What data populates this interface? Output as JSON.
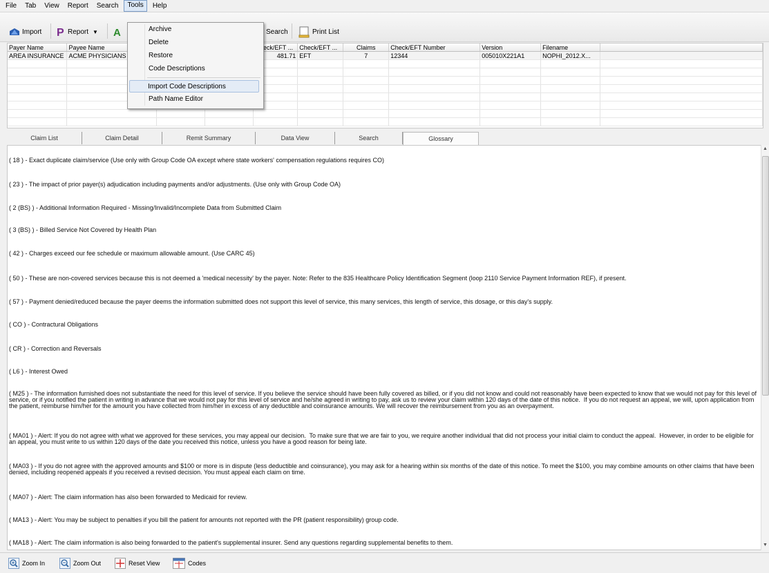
{
  "menubar": {
    "items": [
      "File",
      "Tab",
      "View",
      "Report",
      "Search",
      "Tools",
      "Help"
    ],
    "active": "Tools"
  },
  "toolbar": {
    "import_label": "Import",
    "report_label": "Report",
    "search_label": "Search",
    "print_list_label": "Print List"
  },
  "tools_menu": {
    "items": [
      "Archive",
      "Delete",
      "Restore",
      "Code Descriptions",
      "Import Code Descriptions",
      "Path Name Editor"
    ],
    "highlighted": "Import Code Descriptions"
  },
  "grid": {
    "columns": [
      "Payer Name",
      "Payee Name",
      "",
      "",
      "Check/EFT ...",
      "Check/EFT ...",
      "Claims",
      "Check/EFT Number",
      "Version",
      "Filename"
    ],
    "rows": [
      [
        "AREA INSURANCE",
        "ACME PHYSICIANS",
        "",
        "",
        "481.71",
        "EFT",
        "7",
        "12344",
        "005010X221A1",
        "NOPHI_2012.X..."
      ]
    ]
  },
  "tabs": [
    "Claim List",
    "Claim Detail",
    "Remit Summary",
    "Data View",
    "Search",
    "Glossary"
  ],
  "active_tab": "Glossary",
  "glossary": [
    "( 18 ) - Exact duplicate claim/service (Use only with Group Code OA except where state workers' compensation regulations requires CO)",
    "( 23 ) - The impact of prior payer(s) adjudication including payments and/or adjustments. (Use only with Group Code OA)",
    "( 2 (BS) ) - Additional Information Required - Missing/Invalid/Incomplete Data from Submitted Claim",
    "( 3 (BS) ) - Billed Service Not Covered by Health Plan",
    "( 42 ) - Charges exceed our fee schedule or maximum allowable amount. (Use CARC 45)",
    "( 50 ) - These are non-covered services because this is not deemed a 'medical necessity' by the payer. Note: Refer to the 835 Healthcare Policy Identification Segment (loop 2110 Service Payment Information REF), if present.",
    "( 57 ) - Payment denied/reduced because the payer deems the information submitted does not support this level of service, this many services, this length of service, this dosage, or this day's supply.",
    "( CO ) - Contractural Obligations",
    "( CR ) - Correction and Reversals",
    "( L6 ) - Interest Owed",
    "( M25 ) - The information furnished does not substantiate the need for this level of service. If you believe the service should have been fully covered as billed, or if you did not know and could not reasonably have been expected to know that we would not pay for this level of service, or if you notified the patient in writing in advance that we would not pay for this level of service and he/she agreed in writing to pay, ask us to review your claim within 120 days of the date of this notice.  If you do not request an appeal, we will, upon application from the patient, reimburse him/her for the amount you have collected from him/her in excess of any deductible and coinsurance amounts. We will recover the reimbursement from you as an overpayment.",
    "( MA01 ) - Alert: If you do not agree with what we approved for these services, you may appeal our decision.  To make sure that we are fair to you, we require another individual that did not process your initial claim to conduct the appeal.  However, in order to be eligible for an appeal, you must write to us within 120 days of the date you received this notice, unless you have a good reason for being late.",
    "( MA03 ) - If you do not agree with the approved amounts and $100 or more is in dispute (less deductible and coinsurance), you may ask for a hearing within six months of the date of this notice. To meet the $100, you may combine amounts on other claims that have been denied, including reopened appeals if you received a revised decision. You must appeal each claim on time.",
    "( MA07 ) - Alert: The claim information has also been forwarded to Medicaid for review.",
    "( MA13 ) - Alert: You may be subject to penalties if you bill the patient for amounts not reported with the PR (patient responsibility) group code.",
    "( MA18 ) - Alert: The claim information is also being forwarded to the patient's supplemental insurer. Send any questions regarding supplemental benefits to them."
  ],
  "bottombar": {
    "zoom_in": "Zoom In",
    "zoom_out": "Zoom Out",
    "reset_view": "Reset View",
    "codes": "Codes"
  },
  "colors": {
    "menu_highlight": "#e4ecf6",
    "report_icon": "#7b2d8e",
    "import_icon": "#2a5db0",
    "green_icon": "#2c8a2c"
  }
}
